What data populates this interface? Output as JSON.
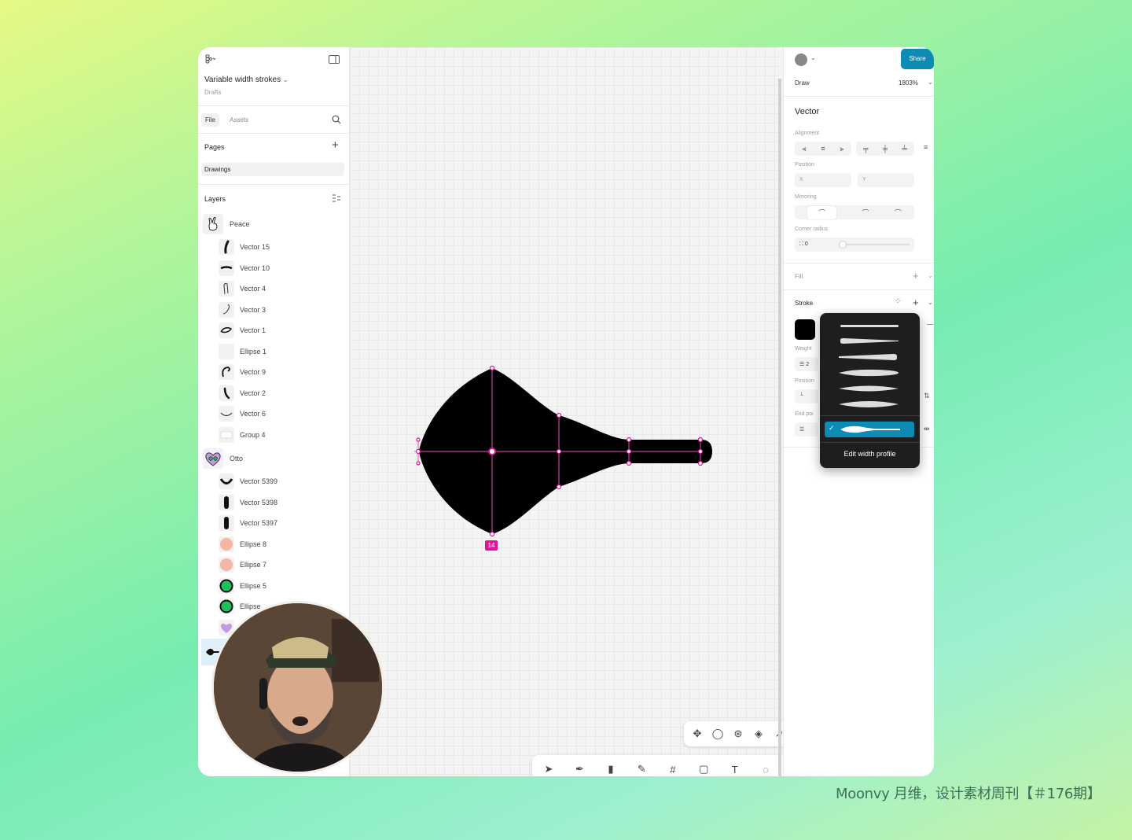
{
  "file": {
    "title": "Variable width strokes",
    "location": "Drafts"
  },
  "tabs": {
    "file": "File",
    "assets": "Assets"
  },
  "pages": {
    "heading": "Pages",
    "current": "Drawings"
  },
  "layers": {
    "heading": "Layers",
    "groups": [
      {
        "name": "Peace",
        "children": [
          "Vector 15",
          "Vector 10",
          "Vector 4",
          "Vector 3",
          "Vector 1",
          "Ellipse 1",
          "Vector 9",
          "Vector 2",
          "Vector 6",
          "Group 4"
        ]
      },
      {
        "name": "Otto",
        "children": [
          "Vector 5399",
          "Vector 5398",
          "Vector 5397",
          "Ellipse 8",
          "Ellipse 7",
          "Ellipse 5",
          "Ellipse"
        ]
      }
    ]
  },
  "right_panel": {
    "share": "Share",
    "mode": "Draw",
    "zoom": "1803%",
    "selection": "Vector",
    "alignment": "Alignment",
    "position": "Position",
    "pos_x": "X",
    "pos_y": "Y",
    "mirroring": "Mirroring",
    "corner_radius": "Corner radius",
    "corner_value": "0",
    "fill": "Fill",
    "stroke": "Stroke",
    "weight": "Weight",
    "weight_value": "2",
    "stroke_position": "Position",
    "end_points": "End poi"
  },
  "width_profile_menu": {
    "edit_label": "Edit width profile",
    "selected_index": 5,
    "count": 6
  },
  "canvas": {
    "measure_label": "14",
    "colors": {
      "accent": "#e0149c",
      "selected": "#0d8bb5"
    }
  },
  "watermark": "Moonvy 月维，设计素材周刊【＃176期】"
}
